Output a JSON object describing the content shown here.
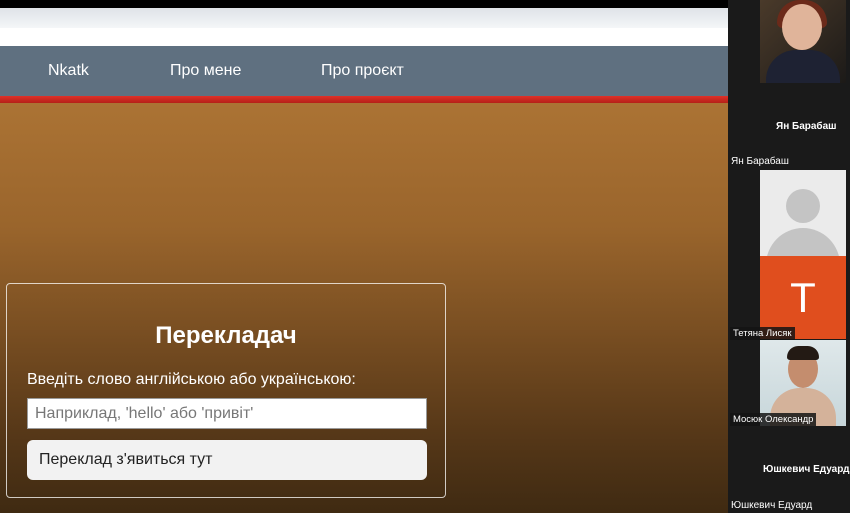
{
  "navbar": {
    "items": [
      {
        "label": "Nkatk"
      },
      {
        "label": "Про мене"
      },
      {
        "label": "Про проєкт"
      }
    ]
  },
  "translator": {
    "title": "Перекладач",
    "prompt": "Введіть слово англійською або українською:",
    "input_value": "",
    "input_placeholder": "Наприклад, 'hello' або 'привіт'",
    "output_text": "Переклад з'явиться тут"
  },
  "participants": [
    {
      "tile_name": "",
      "caption": ""
    },
    {
      "tile_name": "Ян Барабаш",
      "caption": "Ян Барабаш"
    },
    {
      "avatar_letter": "",
      "caption": ""
    },
    {
      "avatar_letter": "T",
      "caption": "Тетяна Лисяк"
    },
    {
      "caption": "Мосюк Олександр"
    },
    {
      "tile_name": "Юшкевич Едуард",
      "caption": "Юшкевич Едуард"
    }
  ],
  "colors": {
    "navbar_bg": "#5f7080",
    "accent_red": "#d02a20",
    "avatar_orange": "#e04e1e",
    "page_brown": "#9a652c"
  }
}
